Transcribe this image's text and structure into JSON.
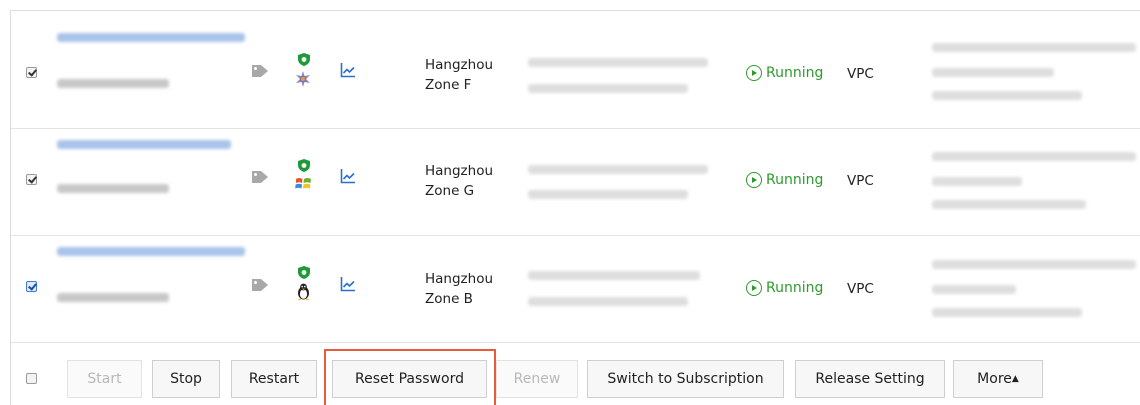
{
  "rows": [
    {
      "region": "Hangzhou",
      "zone": "Zone F",
      "status": "Running",
      "network": "VPC",
      "checked": true,
      "os": "other-linux"
    },
    {
      "region": "Hangzhou",
      "zone": "Zone G",
      "status": "Running",
      "network": "VPC",
      "checked": true,
      "os": "windows"
    },
    {
      "region": "Hangzhou",
      "zone": "Zone B",
      "status": "Running",
      "network": "VPC",
      "checked": true,
      "os": "linux-penguin"
    }
  ],
  "toolbar": {
    "start": "Start",
    "stop": "Stop",
    "restart": "Restart",
    "reset_password": "Reset Password",
    "renew": "Renew",
    "switch_subscription": "Switch to Subscription",
    "release_setting": "Release Setting",
    "more": "More"
  },
  "colors": {
    "running": "#2e9a2e",
    "highlight": "#e85c3a",
    "shield": "#1e9a3a",
    "link": "#2a6fc9"
  },
  "icons": [
    "tag-icon",
    "shield-icon",
    "monitor-chart-icon",
    "running-icon",
    "caret-up-icon"
  ]
}
